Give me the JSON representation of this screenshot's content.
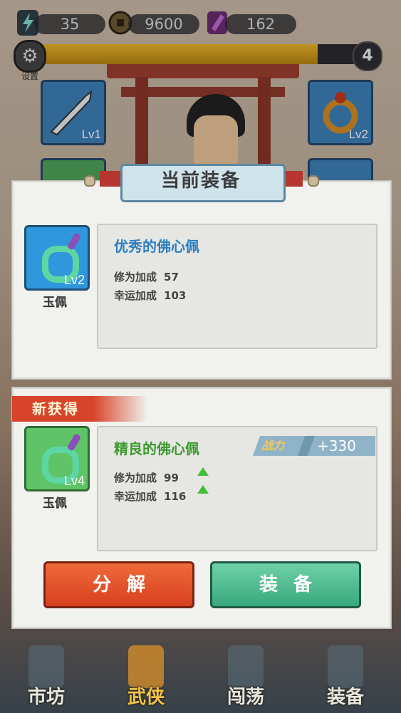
{
  "resources": {
    "energy": "35",
    "coins": "9600",
    "gems": "162"
  },
  "progress": {
    "fill_fraction": 0.83,
    "level": "4"
  },
  "settings_label": "设置",
  "equipped_slots": {
    "weapon_level": "Lv1",
    "ring_level": "Lv2"
  },
  "current_equipment": {
    "title": "当前装备",
    "item_level": "Lv2",
    "item_type": "玉佩",
    "item_name": "优秀的佛心佩",
    "stat1_label": "修为加成",
    "stat1_value": "57",
    "stat2_label": "幸运加成",
    "stat2_value": "103"
  },
  "new_item": {
    "tag": "新获得",
    "item_level": "Lv4",
    "item_type": "玉佩",
    "item_name": "精良的佛心佩",
    "power_label": "战力",
    "power_value": "+330",
    "stat1_label": "修为加成",
    "stat1_value": "99",
    "stat2_label": "幸运加成",
    "stat2_value": "116"
  },
  "actions": {
    "decompose": "分解",
    "equip": "装备"
  },
  "nav": [
    {
      "label": "市坊"
    },
    {
      "label": "武侠"
    },
    {
      "label": "闯荡"
    },
    {
      "label": "装备"
    }
  ],
  "colors": {
    "current_name": "#2b7fc0",
    "new_name": "#3c9b2f",
    "accent_red": "#d8442a",
    "accent_green": "#39a87d"
  }
}
